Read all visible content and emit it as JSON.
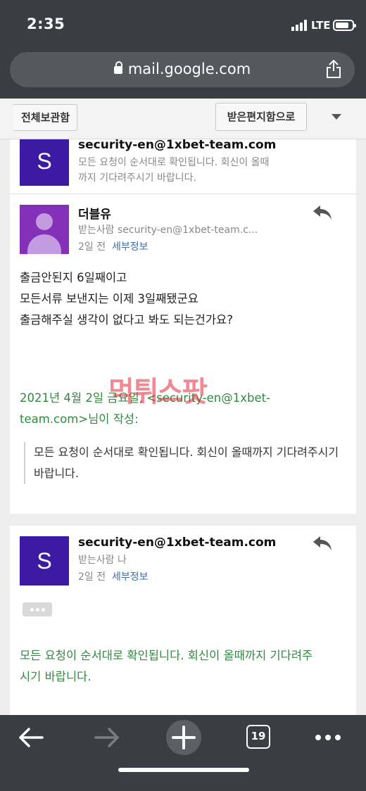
{
  "status": {
    "time": "2:35",
    "network": "LTE"
  },
  "browser": {
    "url": "mail.google.com",
    "tab_count": "19"
  },
  "toolbar": {
    "archive_label": "전체보관함",
    "inbox_label": "받은편지함으로"
  },
  "thread": {
    "message0": {
      "avatar_letter": "S",
      "sender": "security-en@1xbet-team.com",
      "snippet_line1": "모든 요청이 순서대로 확인됩니다. 회신이 올때",
      "snippet_line2": "까지 기다려주시기 바랍니다."
    },
    "message1": {
      "sender": "더블유",
      "to": "받는사람 security-en@1xbet-team.c...",
      "date": "2일 전",
      "details_link": "세부정보",
      "body_line1": "출금안된지 6일째이고",
      "body_line2": "모든서류 보낸지는 이제 3일째됐군요",
      "body_line3": "출금해주실 생각이 없다고 봐도 되는건가요?",
      "quote_header_line1": "2021년 4월 2일 금요일, <security-en@1xbet-",
      "quote_header_line2": "team.com>님이 작성:",
      "quote_text": "모든 요청이 순서대로 확인됩니다. 회신이 올때까지 기다려주시기 바랍니다."
    },
    "message2": {
      "avatar_letter": "S",
      "sender": "security-en@1xbet-team.com",
      "to": "받는사람 나",
      "date": "2일 전",
      "details_link": "세부정보",
      "body_line1": "모든 요청이 순서대로 확인됩니다. 회신이 올때까지 기다려주",
      "body_line2": "시기 바랍니다."
    }
  },
  "watermark": "먹튀스팟",
  "colors": {
    "avatar_s": "#3c1aa3",
    "avatar_person": "#8430b9",
    "quote_green": "#2f8a3f",
    "link_blue": "#3c6fb0",
    "browser_chrome": "#3a3d41"
  }
}
